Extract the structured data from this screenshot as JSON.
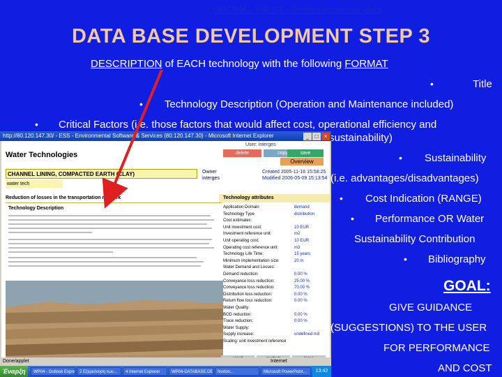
{
  "header": {
    "breadcrumb": "OPTIMA - WP 04 - Techno-economic data"
  },
  "slide": {
    "title": "DATA BASE DEVELOPMENT STEP 3",
    "description": {
      "word1": "DESCRIPTION",
      "mid1": " of ",
      "word2": "EACH",
      "mid2": " technology with the following ",
      "word3": "FORMAT"
    },
    "bullet": "•",
    "items": {
      "title": "Title",
      "tech_desc": "Technology Description (Operation and Maintenance included)",
      "critical_line1": "Critical Factors (i.e. those factors that would affect cost, operational efficiency and",
      "critical_line2": "sustainability)",
      "sust_line1": "Sustainability",
      "sust_line2": "(i.e. advantages/disadvantages)",
      "cost": "Cost Indication (RANGE)",
      "perf_line1": "Performance OR Water",
      "perf_line2": "Sustainability Contribution",
      "biblio": "Bibliography"
    },
    "goal": {
      "label": "GOAL:",
      "line1": "GIVE GUIDANCE",
      "line2": "(SUGGESTIONS) TO THE USER",
      "line3": "FOR PERFORMANCE",
      "line4": "AND COST"
    },
    "colors": {
      "background": "#0f1ee0",
      "title": "#f4c9a0",
      "arrow": "#e02020"
    }
  },
  "window": {
    "titlebar": "http://80.120.147.30/ - ESS - Environmental Software & Services (80.120.147.30) - Microsoft Internet Explorer",
    "app_title": "Water Technologies",
    "login": "User: interges",
    "buttons": {
      "delete": "delete",
      "copy": "copy",
      "save": "save",
      "overview": "Overview"
    },
    "tech_name": "CHANNEL LINING, COMPACTED EARTH (CLAY)",
    "tech_sub": "water tech",
    "owner_label": "Owner",
    "owner_value": "interges",
    "created": "Created 2005-11-16 15:58:25",
    "modified": "Modified 2006-05-09 15:13:54",
    "left_heading": "Reduction of losses in the transportation network",
    "tech_desc_heading": "Technology Description",
    "attributes": {
      "heading": "Technology attributes",
      "rows": [
        {
          "label": "Application Domain",
          "value": "demand"
        },
        {
          "label": "Technology Type",
          "value": "distribution"
        },
        {
          "label": "Cost estimates:",
          "value": ""
        },
        {
          "label": "Unit investment cost:",
          "value": "10 EUR"
        },
        {
          "label": "Investment reference unit:",
          "value": "m2"
        },
        {
          "label": "Unit operating cost:",
          "value": "10 EUR"
        },
        {
          "label": "Operating cost reference unit:",
          "value": "m3"
        },
        {
          "label": "Technology Life Time:",
          "value": "15 years"
        },
        {
          "label": "Minimum implementation size:",
          "value": "20 m"
        },
        {
          "label": "Water Demand and Losses:",
          "value": ""
        },
        {
          "label": "Demand reduction:",
          "value": "0.00 %"
        },
        {
          "label": "Conveyance loss reduction:",
          "value": "25.00 %"
        },
        {
          "label": "Conveyance loss reduction:",
          "value": "70.00 %"
        },
        {
          "label": "Distribution loss reduction:",
          "value": "0.00 %"
        },
        {
          "label": "Return flow loss reduction:",
          "value": "0.00 %"
        },
        {
          "label": "Water Quality:",
          "value": ""
        },
        {
          "label": "BOD reduction:",
          "value": "0.00 %"
        },
        {
          "label": "Trace reduction:",
          "value": "0.00 %"
        },
        {
          "label": "Water Supply:",
          "value": ""
        },
        {
          "label": "Supply increase:",
          "value": "undefined m3"
        },
        {
          "label": "Scaling: unit investment reference",
          "value": ""
        }
      ],
      "buttons": [
        "small",
        "medium",
        "large"
      ]
    },
    "status": "Done/applet",
    "status_right": "Internet",
    "taskbar": {
      "start": "Έναρξη",
      "tasks": [
        "WP04 - Outlook Express",
        "2 Εξερεύνηση των...",
        "4 Internet Explorer",
        "WP04-DATABASE.DE...",
        "Norton...",
        "Microsoft PowerPoint..."
      ],
      "clock": "13:42"
    }
  }
}
